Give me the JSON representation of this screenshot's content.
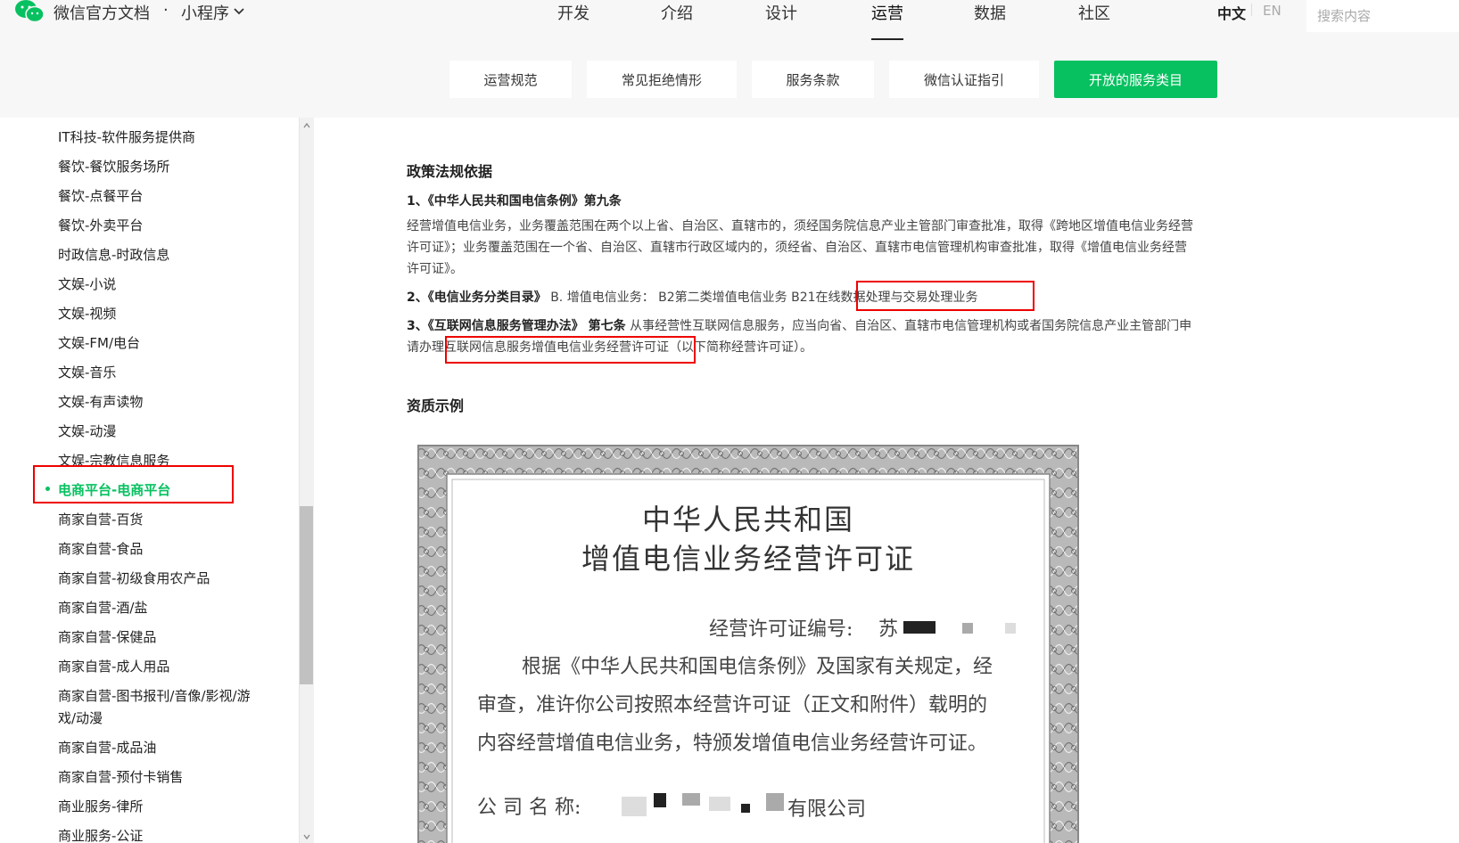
{
  "header": {
    "brand": "微信官方文档",
    "separator": "·",
    "product": "小程序",
    "nav": [
      "开发",
      "介绍",
      "设计",
      "运营",
      "数据",
      "社区"
    ],
    "active_nav": "运营",
    "lang_zh": "中文",
    "lang_en": "EN",
    "search_placeholder": "搜索内容",
    "brand_color": "#07c160"
  },
  "subtabs": [
    "运营规范",
    "常见拒绝情形",
    "服务条款",
    "微信认证指引",
    "开放的服务类目"
  ],
  "sidebar": {
    "items": [
      "IT科技-软件服务提供商",
      "餐饮-餐饮服务场所",
      "餐饮-点餐平台",
      "餐饮-外卖平台",
      "时政信息-时政信息",
      "文娱-小说",
      "文娱-视频",
      "文娱-FM/电台",
      "文娱-音乐",
      "文娱-有声读物",
      "文娱-动漫",
      "文娱-宗教信息服务",
      "电商平台-电商平台",
      "商家自营-百货",
      "商家自营-食品",
      "商家自营-初级食用农产品",
      "商家自营-酒/盐",
      "商家自营-保健品",
      "商家自营-成人用品",
      "商家自营-图书报刊/音像/影视/游",
      "戏/动漫",
      "商家自营-成品油",
      "商家自营-预付卡销售",
      "商业服务-律所",
      "商业服务-公证"
    ],
    "active": "电商平台-电商平台"
  },
  "content": {
    "policy_heading": "政策法规依据",
    "law1_title": "1、《中华人民共和国电信条例》第九条",
    "law1_text_line1": "经营增值电信业务，业务覆盖范围在两个以上省、自治区、直辖市的，须经国务院信息产业主管部门审查批准，取得《跨地区增值电信业务经营",
    "law1_text_line2": "许可证》；业务覆盖范围在一个省、自治区、直辖市行政区域内的，须经省、自治区、直辖市电信管理机构审查批准，取得《增值电信业务经营",
    "law1_text_line3": "许可证》。",
    "law2_prefix": "2、《电信业务分类目录》",
    "law2_text": " B. 增值电信业务： B2第二类增值电信业务 B21",
    "law2_highlight": "在线数据处理与交易处理业务",
    "law3_prefix": "3、《互联网信息服务管理办法》 第七条",
    "law3_text": " 从事经营性互联网信息服务，应当向省、自治区、直辖市电信管理机构或者国务院信息产业主管部门申",
    "law3_line2_prefix": "请办理",
    "law3_highlight": "互联网信息服务增值电信业务经营许可证",
    "law3_line2_suffix": "（以下简称经营许可证）。",
    "example_heading": "资质示例"
  },
  "certificate": {
    "title_line1": "中华人民共和国",
    "title_line2": "增值电信业务经营许可证",
    "number_label": "经营许可证编号:",
    "number_value": "苏",
    "body_line1": "根据《中华人民共和国电信条例》及国家有关规定，经",
    "body_line2": "审查，准许你公司按照本经营许可证（正文和附件）载明的",
    "body_line3": "内容经营增值电信业务，特颁发增值电信业务经营许可证。",
    "company_label": "公  司  名  称:",
    "company_suffix": "有限公司"
  }
}
